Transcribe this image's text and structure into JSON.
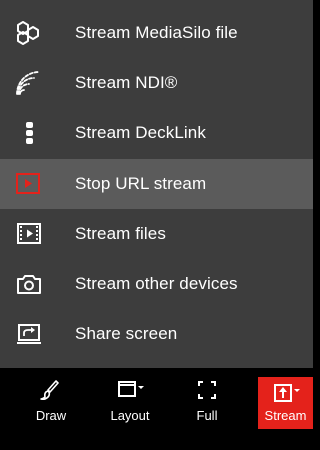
{
  "menu": {
    "items": [
      {
        "label": "Stream MediaSilo file",
        "icon": "mediasilo-icon"
      },
      {
        "label": "Stream NDI®",
        "icon": "ndi-signal-icon"
      },
      {
        "label": "Stream DeckLink",
        "icon": "decklink-icon"
      },
      {
        "label": "Stop URL stream",
        "icon": "url-stream-icon",
        "active": true
      },
      {
        "label": "Stream files",
        "icon": "film-icon"
      },
      {
        "label": "Stream other devices",
        "icon": "camera-icon"
      },
      {
        "label": "Share screen",
        "icon": "screen-share-icon"
      }
    ]
  },
  "toolbar": {
    "draw_label": "Draw",
    "layout_label": "Layout",
    "full_label": "Full",
    "stream_label": "Stream"
  },
  "colors": {
    "menu_bg": "#3d3d3d",
    "active_bg": "#5b5b5b",
    "accent_red": "#e4221b",
    "toolbar_bg": "#000000"
  }
}
